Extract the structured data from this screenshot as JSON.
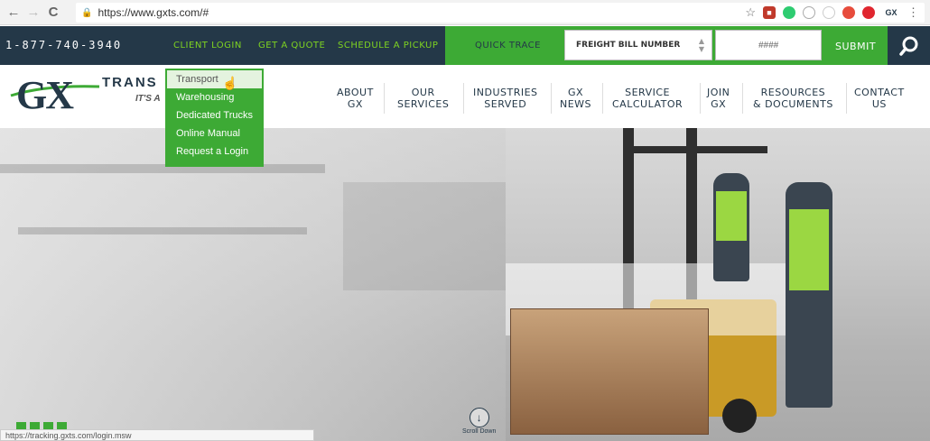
{
  "browser": {
    "url": "https://www.gxts.com/#",
    "nav_back": "←",
    "nav_forward": "→",
    "nav_reload": "C"
  },
  "topbar": {
    "phone": "1-877-740-3940",
    "links": [
      "CLIENT LOGIN",
      "GET A QUOTE",
      "SCHEDULE A PICKUP"
    ],
    "quick_trace": "QUICK TRACE",
    "freight_select": "FREIGHT BILL NUMBER",
    "number_placeholder": "####",
    "submit": "SUBMIT"
  },
  "logo": {
    "gx": "GX",
    "trans": "TRANS",
    "tagline": "IT'S A"
  },
  "nav": [
    {
      "line1": "ABOUT",
      "line2": "GX"
    },
    {
      "line1": "OUR",
      "line2": "SERVICES"
    },
    {
      "line1": "INDUSTRIES",
      "line2": "SERVED"
    },
    {
      "line1": "GX",
      "line2": "NEWS"
    },
    {
      "line1": "SERVICE",
      "line2": "CALCULATOR"
    },
    {
      "line1": "JOIN",
      "line2": "GX"
    },
    {
      "line1": "RESOURCES",
      "line2": "& DOCUMENTS"
    },
    {
      "line1": "CONTACT",
      "line2": "US"
    }
  ],
  "dropdown": [
    "Transport",
    "Warehousing",
    "Dedicated Trucks",
    "Online Manual",
    "Request a Login"
  ],
  "hero": {
    "scroll_label": "Scroll Down"
  },
  "status_url": "https://tracking.gxts.com/login.msw",
  "colors": {
    "navy": "#243848",
    "green": "#3daa35",
    "link_green": "#7ed321"
  },
  "icons": [
    "back-arrow-icon",
    "forward-arrow-icon",
    "reload-icon",
    "lock-icon",
    "star-icon",
    "search-icon",
    "scroll-down-arrow-icon"
  ]
}
